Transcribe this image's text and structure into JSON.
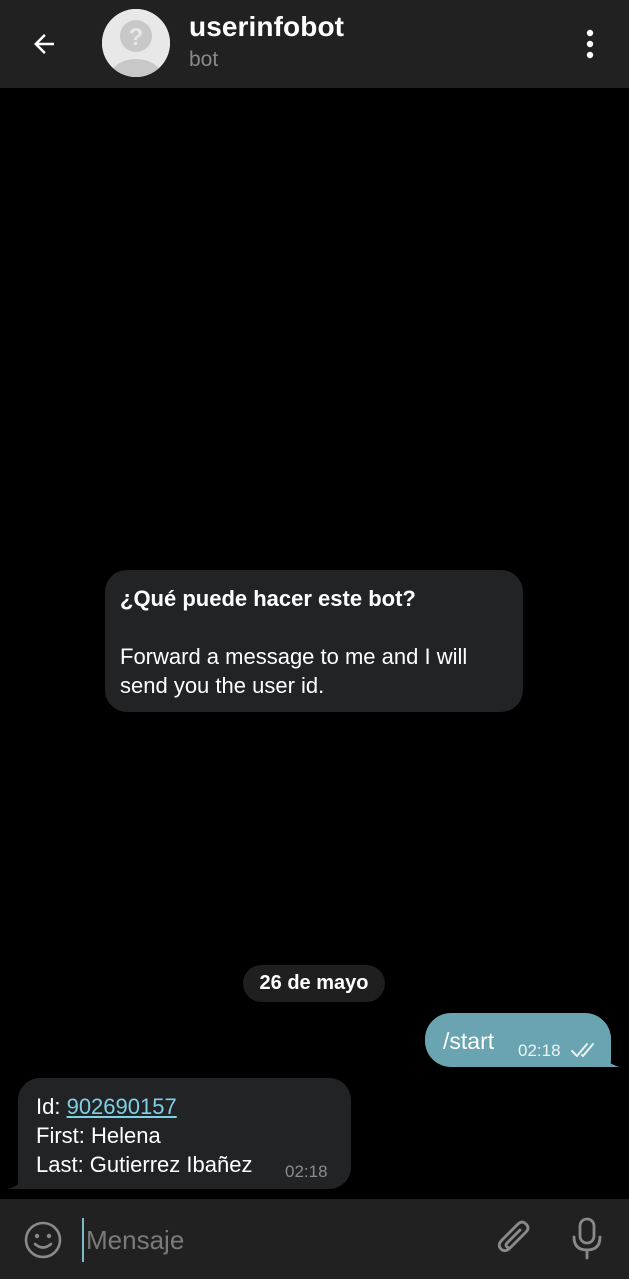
{
  "header": {
    "title": "userinfobot",
    "subtitle": "bot",
    "back_icon": "arrow-left-icon",
    "menu_icon": "more-vertical-icon",
    "avatar_icon": "user-placeholder-icon"
  },
  "bot_info": {
    "title": "¿Qué puede hacer este bot?",
    "body_line1": "Forward a message to me and I will",
    "body_line2": "send you the user id."
  },
  "date_separator": "26 de mayo",
  "messages": {
    "outgoing": {
      "text": "/start",
      "time": "02:18",
      "status_icon": "double-check-icon"
    },
    "incoming": {
      "id_label": "Id: ",
      "id_value": "902690157",
      "first": "First: Helena",
      "last": "Last: Gutierrez Ibañez",
      "time": "02:18"
    }
  },
  "composer": {
    "placeholder": "Mensaje",
    "emoji_icon": "emoji-icon",
    "attach_icon": "paperclip-icon",
    "mic_icon": "microphone-icon"
  },
  "colors": {
    "header_bg": "#212121",
    "chat_bg": "#000000",
    "incoming_bubble": "#222324",
    "outgoing_bubble": "#6ba4b1",
    "link": "#7fd0e6"
  }
}
